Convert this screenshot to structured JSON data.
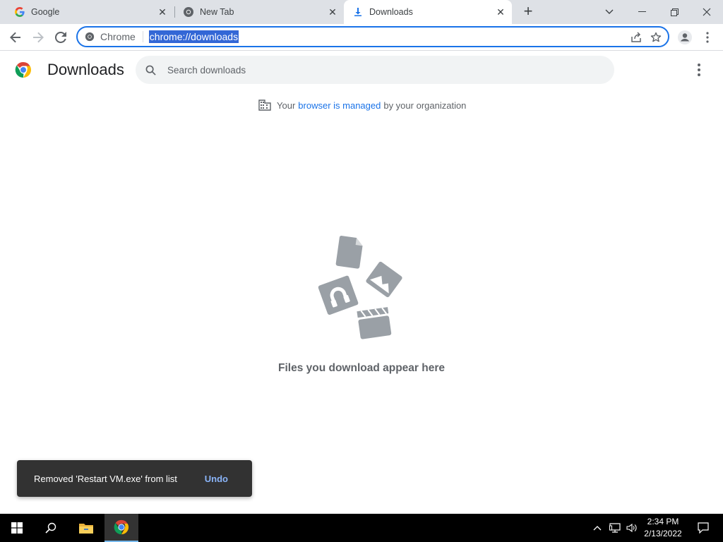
{
  "tabs": [
    {
      "title": "Google",
      "icon": "google-g-icon",
      "active": false
    },
    {
      "title": "New Tab",
      "icon": "chrome-icon",
      "active": false
    },
    {
      "title": "Downloads",
      "icon": "download-icon",
      "active": true
    }
  ],
  "omnibox": {
    "chip_label": "Chrome",
    "url": "chrome://downloads"
  },
  "page": {
    "title": "Downloads",
    "search_placeholder": "Search downloads",
    "managed_prefix": "Your",
    "managed_link": "browser is managed",
    "managed_suffix": "by your organization",
    "empty_message": "Files you download appear here"
  },
  "toast": {
    "message": "Removed 'Restart VM.exe' from list",
    "action": "Undo"
  },
  "taskbar": {
    "time": "2:34 PM",
    "date": "2/13/2022"
  },
  "colors": {
    "accent": "#1a73e8",
    "tabstrip": "#dee1e6",
    "toast_bg": "#323232",
    "toast_action": "#8ab4f8"
  }
}
